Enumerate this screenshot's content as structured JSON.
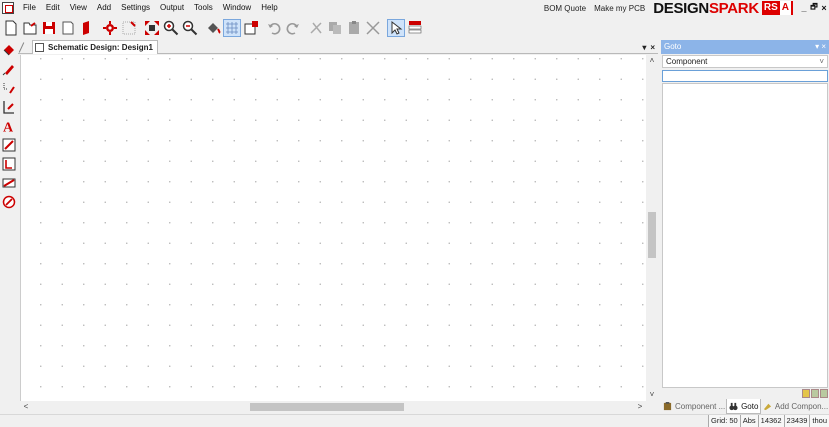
{
  "menu": {
    "items": [
      "File",
      "Edit",
      "View",
      "Add",
      "Settings",
      "Output",
      "Tools",
      "Window",
      "Help"
    ],
    "bom_quote": "BOM Quote",
    "make_pcb": "Make my PCB"
  },
  "brand": {
    "design": "DESIGN",
    "spark": "SPARK",
    "rs": "RS",
    "a": "A"
  },
  "window_controls": {
    "minimize": "_",
    "restore": "3",
    "close": "×"
  },
  "toolbar": {
    "icons": [
      "new-icon",
      "open-icon",
      "save-icon",
      "close-doc-icon",
      "library-icon",
      "settings-icon",
      "grid-icon",
      "zoom-extents-icon",
      "zoom-in-icon",
      "zoom-out-icon",
      "fill-icon",
      "grid-toggle-icon",
      "properties-icon",
      "undo-icon",
      "redo-icon",
      "cut-icon",
      "copy-icon",
      "paste-icon",
      "delete-icon",
      "select-icon",
      "interaction-bar-icon"
    ]
  },
  "document": {
    "tab_title": "Schematic Design: Design1",
    "tab_menu": "▾",
    "tab_close": "×",
    "scroll_up": "^",
    "scroll_down": "˅",
    "scroll_left": "<",
    "scroll_right": ">"
  },
  "panel": {
    "title": "Goto",
    "controls": "▾ ×",
    "dropdown_value": "Component",
    "dropdown_chevron": "˅",
    "search_value": "",
    "tabs": [
      {
        "label": "Component ...",
        "icon": "component-icon",
        "active": false
      },
      {
        "label": "Goto",
        "icon": "binoculars-icon",
        "active": true
      },
      {
        "label": "Add Compon...",
        "icon": "add-component-icon",
        "active": false
      }
    ]
  },
  "status": {
    "grid": "Grid: 50",
    "abs": "Abs",
    "x": "14362",
    "y": "23439",
    "units": "thou"
  }
}
